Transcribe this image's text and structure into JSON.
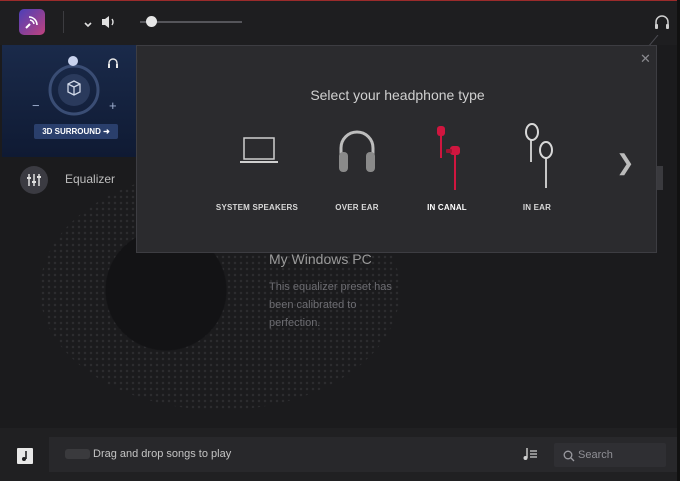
{
  "popup": {
    "title": "Select your headphone type",
    "options": [
      {
        "label": "SYSTEM SPEAKERS",
        "icon": "laptop-icon",
        "selected": false
      },
      {
        "label": "OVER EAR",
        "icon": "over-ear-headphones-icon",
        "selected": false
      },
      {
        "label": "IN CANAL",
        "icon": "in-canal-earbuds-icon",
        "selected": true
      },
      {
        "label": "IN EAR",
        "icon": "in-ear-earbuds-icon",
        "selected": false
      }
    ]
  },
  "left_panel": {
    "surround_label": "3D SURROUND ➜",
    "minus": "−",
    "plus": "+"
  },
  "equalizer": {
    "label": "Equalizer",
    "preset_title": "My Windows PC",
    "preset_desc": "This equalizer preset has been calibrated to perfection."
  },
  "footer": {
    "drag_text": "Drag and drop songs to play",
    "search_placeholder": "Search"
  },
  "colors": {
    "accent_selected": "#d0163f",
    "surround_button": "#2a3f6c",
    "background": "#1b1b1d"
  }
}
